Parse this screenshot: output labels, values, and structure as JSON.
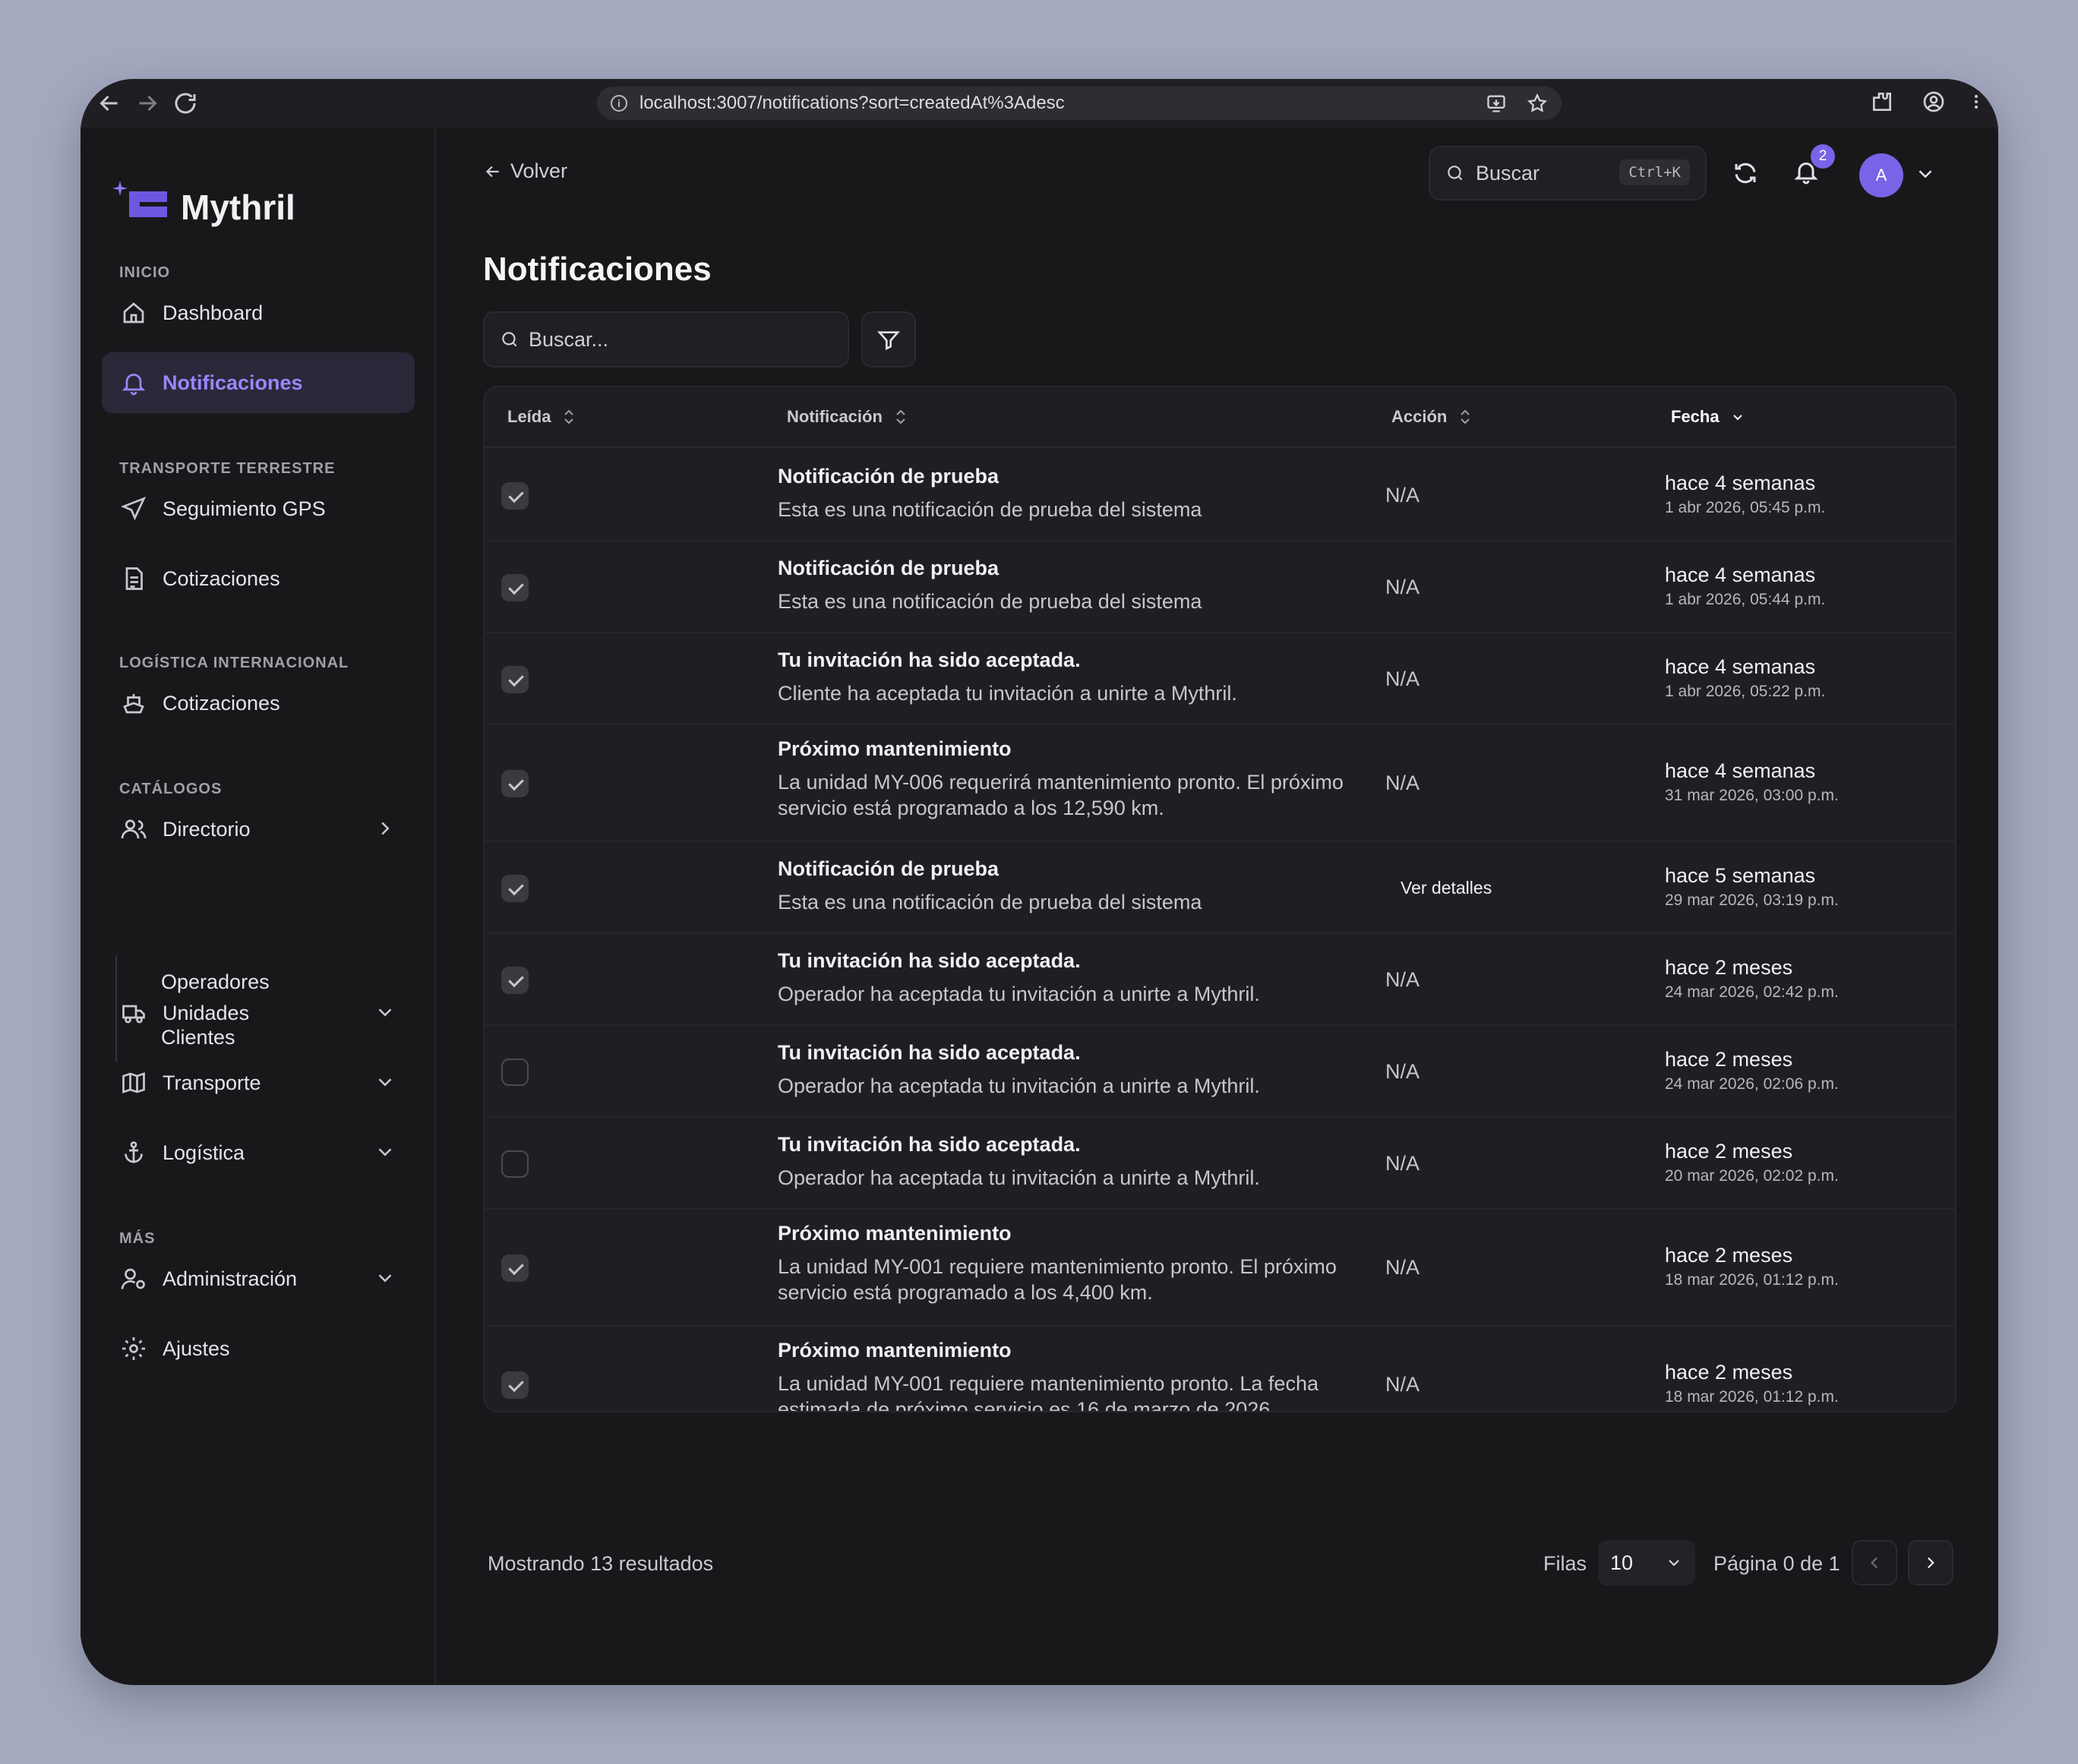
{
  "browser": {
    "url": "localhost:3007/notifications?sort=createdAt%3Adesc"
  },
  "app": {
    "name": "Mythril"
  },
  "sidebar": {
    "sections": [
      {
        "label": "INICIO"
      },
      {
        "label": "TRANSPORTE TERRESTRE"
      },
      {
        "label": "LOGÍSTICA INTERNACIONAL"
      },
      {
        "label": "CATÁLOGOS"
      },
      {
        "label": "MÁS"
      }
    ],
    "items": {
      "dashboard": "Dashboard",
      "notificaciones": "Notificaciones",
      "gps": "Seguimiento GPS",
      "cotizaciones_terrestre": "Cotizaciones",
      "cotizaciones_intl": "Cotizaciones",
      "directorio": "Directorio",
      "operadores": "Operadores",
      "clientes": "Clientes",
      "unidades": "Unidades",
      "transporte": "Transporte",
      "logistica": "Logística",
      "administracion": "Administración",
      "ajustes": "Ajustes"
    }
  },
  "header": {
    "back_label": "Volver",
    "search_placeholder": "Buscar",
    "search_shortcut": "Ctrl+K",
    "notification_count": "2",
    "avatar_initial": "A"
  },
  "page": {
    "title": "Notificaciones",
    "search_placeholder": "Buscar..."
  },
  "table": {
    "columns": [
      "Leída",
      "Notificación",
      "Acción",
      "Fecha"
    ],
    "rows": [
      {
        "read": true,
        "title": "Notificación de prueba",
        "desc": "Esta es una notificación de prueba del sistema",
        "action": "N/A",
        "relative": "hace 4 semanas",
        "date": "1 abr 2026, 05:45 p.m."
      },
      {
        "read": true,
        "title": "Notificación de prueba",
        "desc": "Esta es una notificación de prueba del sistema",
        "action": "N/A",
        "relative": "hace 4 semanas",
        "date": "1 abr 2026, 05:44 p.m."
      },
      {
        "read": true,
        "title": "Tu invitación ha sido aceptada.",
        "desc": "Cliente ha aceptada tu invitación a unirte a Mythril.",
        "action": "N/A",
        "relative": "hace 4 semanas",
        "date": "1 abr 2026, 05:22 p.m."
      },
      {
        "read": true,
        "title": "Próximo mantenimiento",
        "desc": "La unidad MY-006 requerirá mantenimiento pronto. El próximo servicio está programado a los 12,590 km.",
        "action": "N/A",
        "relative": "hace 4 semanas",
        "date": "31 mar 2026, 03:00 p.m."
      },
      {
        "read": true,
        "title": "Notificación de prueba",
        "desc": "Esta es una notificación de prueba del sistema",
        "action": "Ver detalles",
        "relative": "hace 5 semanas",
        "date": "29 mar 2026, 03:19 p.m."
      },
      {
        "read": true,
        "title": "Tu invitación ha sido aceptada.",
        "desc": "Operador ha aceptada tu invitación a unirte a Mythril.",
        "action": "N/A",
        "relative": "hace 2 meses",
        "date": "24 mar 2026, 02:42 p.m."
      },
      {
        "read": false,
        "title": "Tu invitación ha sido aceptada.",
        "desc": "Operador ha aceptada tu invitación a unirte a Mythril.",
        "action": "N/A",
        "relative": "hace 2 meses",
        "date": "24 mar 2026, 02:06 p.m."
      },
      {
        "read": false,
        "title": "Tu invitación ha sido aceptada.",
        "desc": "Operador ha aceptada tu invitación a unirte a Mythril.",
        "action": "N/A",
        "relative": "hace 2 meses",
        "date": "20 mar 2026, 02:02 p.m."
      },
      {
        "read": true,
        "title": "Próximo mantenimiento",
        "desc": "La unidad MY-001 requiere mantenimiento pronto. El próximo servicio está programado a los 4,400 km.",
        "action": "N/A",
        "relative": "hace 2 meses",
        "date": "18 mar 2026, 01:12 p.m."
      },
      {
        "read": true,
        "title": "Próximo mantenimiento",
        "desc": "La unidad MY-001 requiere mantenimiento pronto. La fecha estimada de próximo servicio es 16 de marzo de 2026.",
        "action": "N/A",
        "relative": "hace 2 meses",
        "date": "18 mar 2026, 01:12 p.m."
      }
    ]
  },
  "footer": {
    "results": "Mostrando 13 resultados",
    "rows_label": "Filas",
    "rows_value": "10",
    "page_info": "Página 0 de 1"
  },
  "colors": {
    "accent": "#7b63e8",
    "background": "#18181b",
    "surface": "#1f1f23"
  }
}
